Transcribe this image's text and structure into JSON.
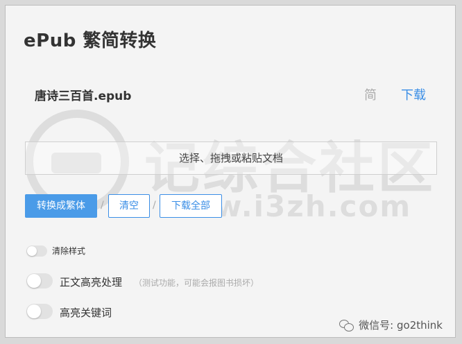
{
  "app": {
    "title": "ePub 繁简转换"
  },
  "file": {
    "name": "唐诗三百首.epub",
    "lang": "简",
    "download": "下载"
  },
  "watermark": {
    "text": "记综合社区",
    "url": "www.i3zh.com"
  },
  "drop_zone": {
    "label": "选择、拖拽或粘贴文档"
  },
  "actions": {
    "convert": "转换成繁体",
    "separator": "/",
    "clear": "清空",
    "download_all": "下载全部"
  },
  "options": {
    "clear_style": {
      "label": "清除样式",
      "enabled": false
    },
    "highlight_text": {
      "label": "正文高亮处理",
      "hint": "（测试功能，可能会报图书损坏）",
      "enabled": false
    },
    "highlight_keywords": {
      "label": "高亮关键词",
      "enabled": false
    }
  },
  "footer": {
    "wechat_label": "微信号: go2think",
    "icon": "wechat-icon"
  },
  "colors": {
    "accent": "#3a8ee6",
    "primary_button": "#4a9be8",
    "background": "#f4f4f4"
  }
}
